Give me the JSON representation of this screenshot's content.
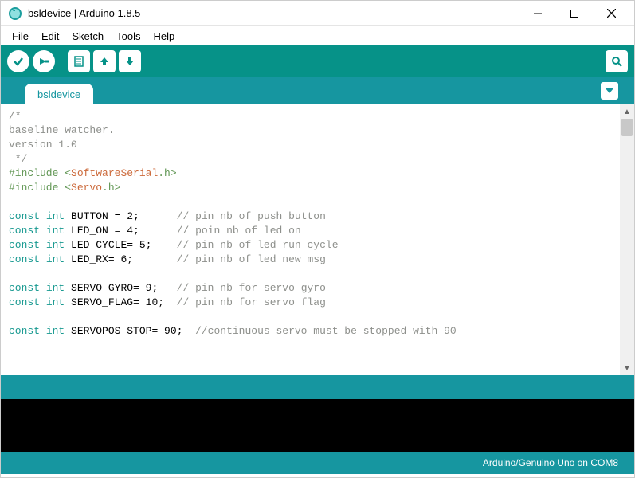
{
  "window": {
    "title": "bsldevice | Arduino 1.8.5"
  },
  "menubar": {
    "file": "File",
    "edit": "Edit",
    "sketch": "Sketch",
    "tools": "Tools",
    "help": "Help"
  },
  "tabs": {
    "active": "bsldevice"
  },
  "code": {
    "l1": "/*",
    "l2": "baseline watcher.",
    "l3": "version 1.0",
    "l4": " */",
    "l5a": "#include",
    "l5b": " <",
    "l5c": "SoftwareSerial",
    "l5d": ".h>",
    "l6a": "#include",
    "l6b": " <",
    "l6c": "Servo",
    "l6d": ".h>",
    "l8a": "const",
    "l8b": " int",
    "l8c": " BUTTON = 2;      ",
    "l8d": "// pin nb of push button",
    "l9a": "const",
    "l9b": " int",
    "l9c": " LED_ON = 4;      ",
    "l9d": "// poin nb of led on",
    "l10a": "const",
    "l10b": " int",
    "l10c": " LED_CYCLE= 5;    ",
    "l10d": "// pin nb of led run cycle",
    "l11a": "const",
    "l11b": " int",
    "l11c": " LED_RX= 6;       ",
    "l11d": "// pin nb of led new msg",
    "l13a": "const",
    "l13b": " int",
    "l13c": " SERVO_GYRO= 9;   ",
    "l13d": "// pin nb for servo gyro",
    "l14a": "const",
    "l14b": " int",
    "l14c": " SERVO_FLAG= 10;  ",
    "l14d": "// pin nb for servo flag",
    "l16a": "const",
    "l16b": " int",
    "l16c": " SERVOPOS_STOP= 90;  ",
    "l16d": "//continuous servo must be stopped with 90"
  },
  "status": {
    "board": "Arduino/Genuino Uno on COM8"
  }
}
